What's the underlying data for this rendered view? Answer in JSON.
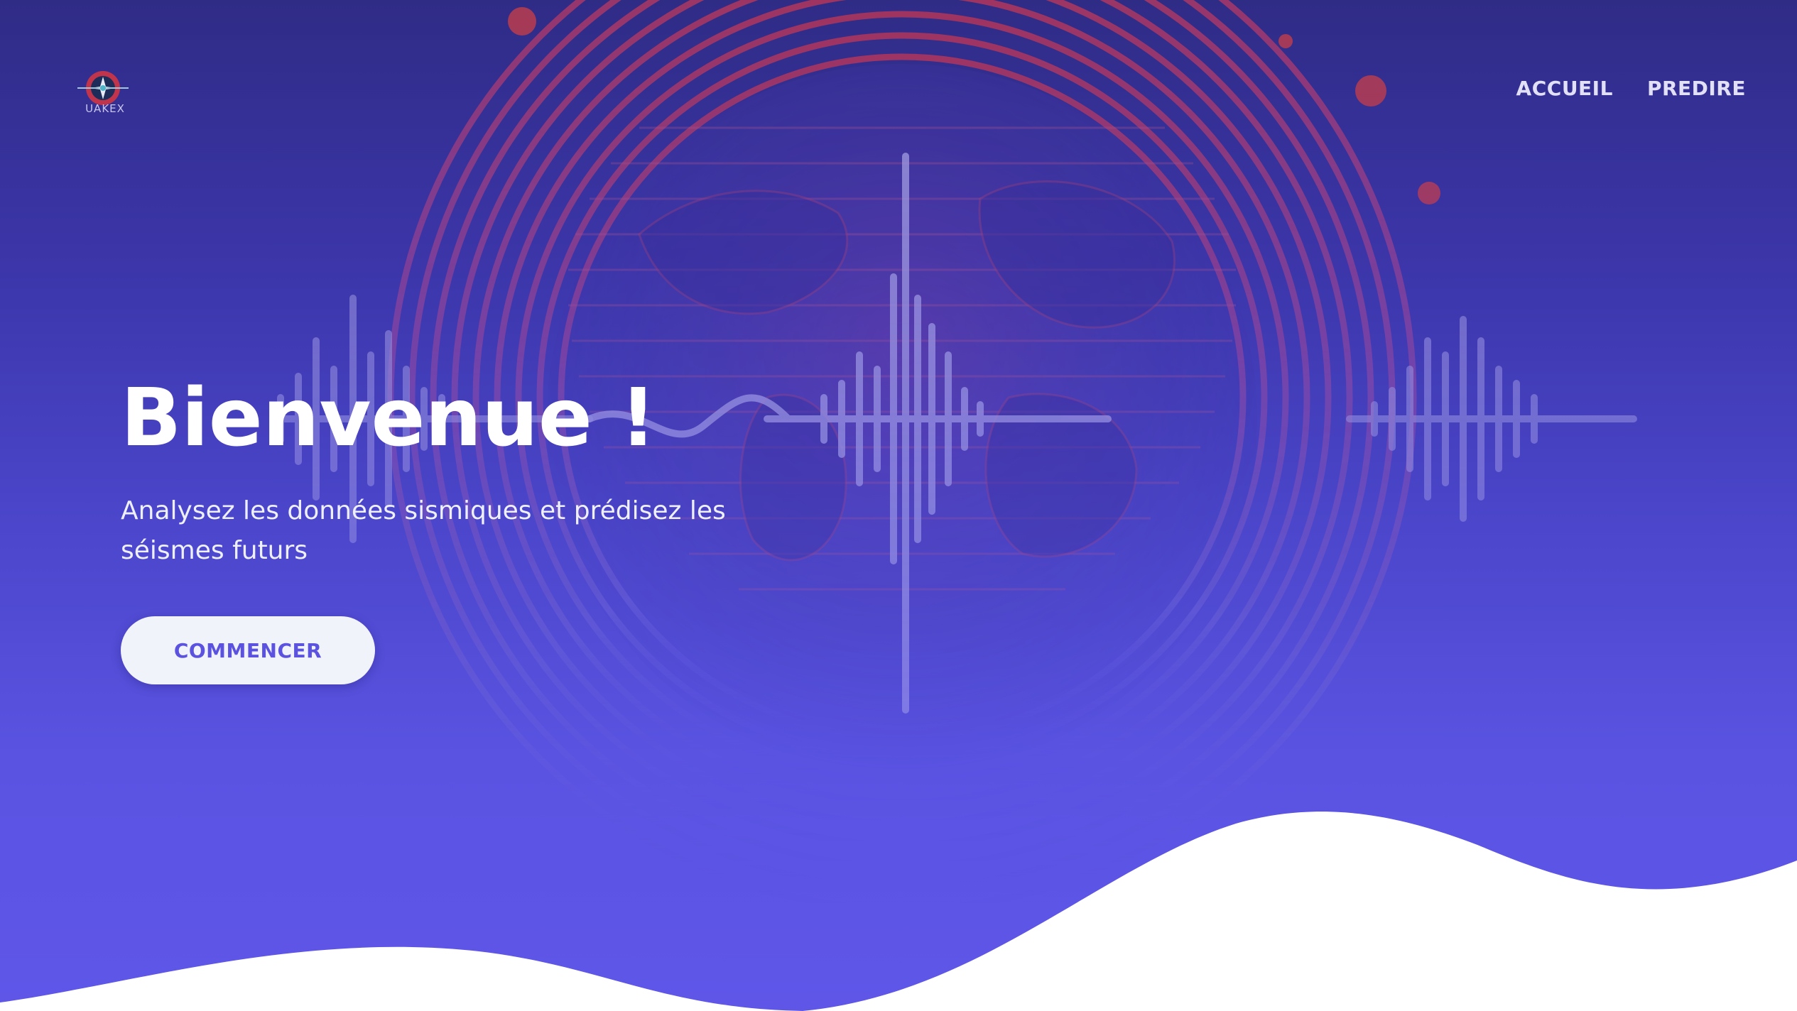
{
  "brand": {
    "logo_text": "UAKEX",
    "logo_icon": "seismic-globe-logo-icon"
  },
  "nav": {
    "items": [
      {
        "label": "ACCUEIL"
      },
      {
        "label": "PREDIRE"
      }
    ]
  },
  "hero": {
    "title": "Bienvenue !",
    "subtitle": "Analysez les données sismiques et prédisez les séismes futurs",
    "cta_label": "COMMENCER",
    "background_art": "seismic-globe-waveform-illustration"
  },
  "colors": {
    "gradient_top": "#2f2c86",
    "gradient_bottom": "#5f56e8",
    "accent": "#5b53e0",
    "button_bg": "#f1f3fb",
    "wave_fill": "#ffffff"
  }
}
